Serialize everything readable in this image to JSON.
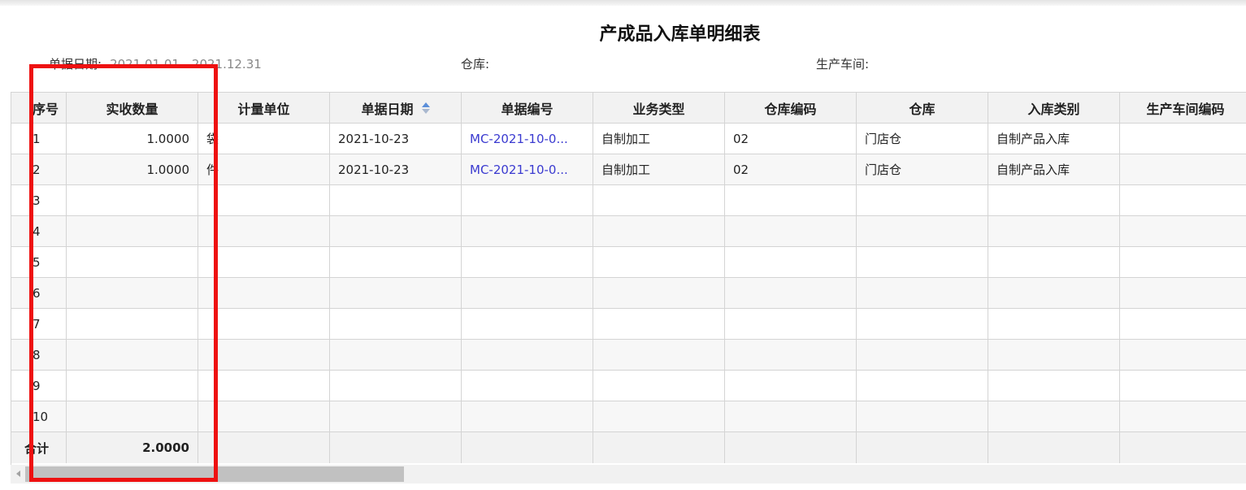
{
  "title": "产成品入库单明细表",
  "filters": {
    "date_label": "单据日期:",
    "date_value": "2021.01.01 - 2021.12.31",
    "warehouse_label": "仓库:",
    "workshop_label": "生产车间:"
  },
  "columns": [
    "序号",
    "实收数量",
    "计量单位",
    "单据日期",
    "单据编号",
    "业务类型",
    "仓库编码",
    "仓库",
    "入库类别",
    "生产车间编码"
  ],
  "rows": [
    {
      "no": "1",
      "qty": "1.0000",
      "unit": "袋",
      "date": "2021-10-23",
      "doc_no": "MC-2021-10-0...",
      "biz_type": "自制加工",
      "wh_code": "02",
      "wh": "门店仓",
      "in_type": "自制产品入库",
      "ws_code": ""
    },
    {
      "no": "2",
      "qty": "1.0000",
      "unit": "件",
      "date": "2021-10-23",
      "doc_no": "MC-2021-10-0...",
      "biz_type": "自制加工",
      "wh_code": "02",
      "wh": "门店仓",
      "in_type": "自制产品入库",
      "ws_code": ""
    },
    {
      "no": "3",
      "qty": "",
      "unit": "",
      "date": "",
      "doc_no": "",
      "biz_type": "",
      "wh_code": "",
      "wh": "",
      "in_type": "",
      "ws_code": ""
    },
    {
      "no": "4",
      "qty": "",
      "unit": "",
      "date": "",
      "doc_no": "",
      "biz_type": "",
      "wh_code": "",
      "wh": "",
      "in_type": "",
      "ws_code": ""
    },
    {
      "no": "5",
      "qty": "",
      "unit": "",
      "date": "",
      "doc_no": "",
      "biz_type": "",
      "wh_code": "",
      "wh": "",
      "in_type": "",
      "ws_code": ""
    },
    {
      "no": "6",
      "qty": "",
      "unit": "",
      "date": "",
      "doc_no": "",
      "biz_type": "",
      "wh_code": "",
      "wh": "",
      "in_type": "",
      "ws_code": ""
    },
    {
      "no": "7",
      "qty": "",
      "unit": "",
      "date": "",
      "doc_no": "",
      "biz_type": "",
      "wh_code": "",
      "wh": "",
      "in_type": "",
      "ws_code": ""
    },
    {
      "no": "8",
      "qty": "",
      "unit": "",
      "date": "",
      "doc_no": "",
      "biz_type": "",
      "wh_code": "",
      "wh": "",
      "in_type": "",
      "ws_code": ""
    },
    {
      "no": "9",
      "qty": "",
      "unit": "",
      "date": "",
      "doc_no": "",
      "biz_type": "",
      "wh_code": "",
      "wh": "",
      "in_type": "",
      "ws_code": ""
    },
    {
      "no": "10",
      "qty": "",
      "unit": "",
      "date": "",
      "doc_no": "",
      "biz_type": "",
      "wh_code": "",
      "wh": "",
      "in_type": "",
      "ws_code": ""
    }
  ],
  "total": {
    "label": "合计",
    "qty": "2.0000"
  },
  "colors": {
    "link": "#3a3ad0",
    "highlight": "#ee1111",
    "sort_active": "#5b8fd9"
  },
  "icons": {
    "sort": "sort-asc-icon",
    "scroll_left": "scroll-left-arrow-icon"
  }
}
